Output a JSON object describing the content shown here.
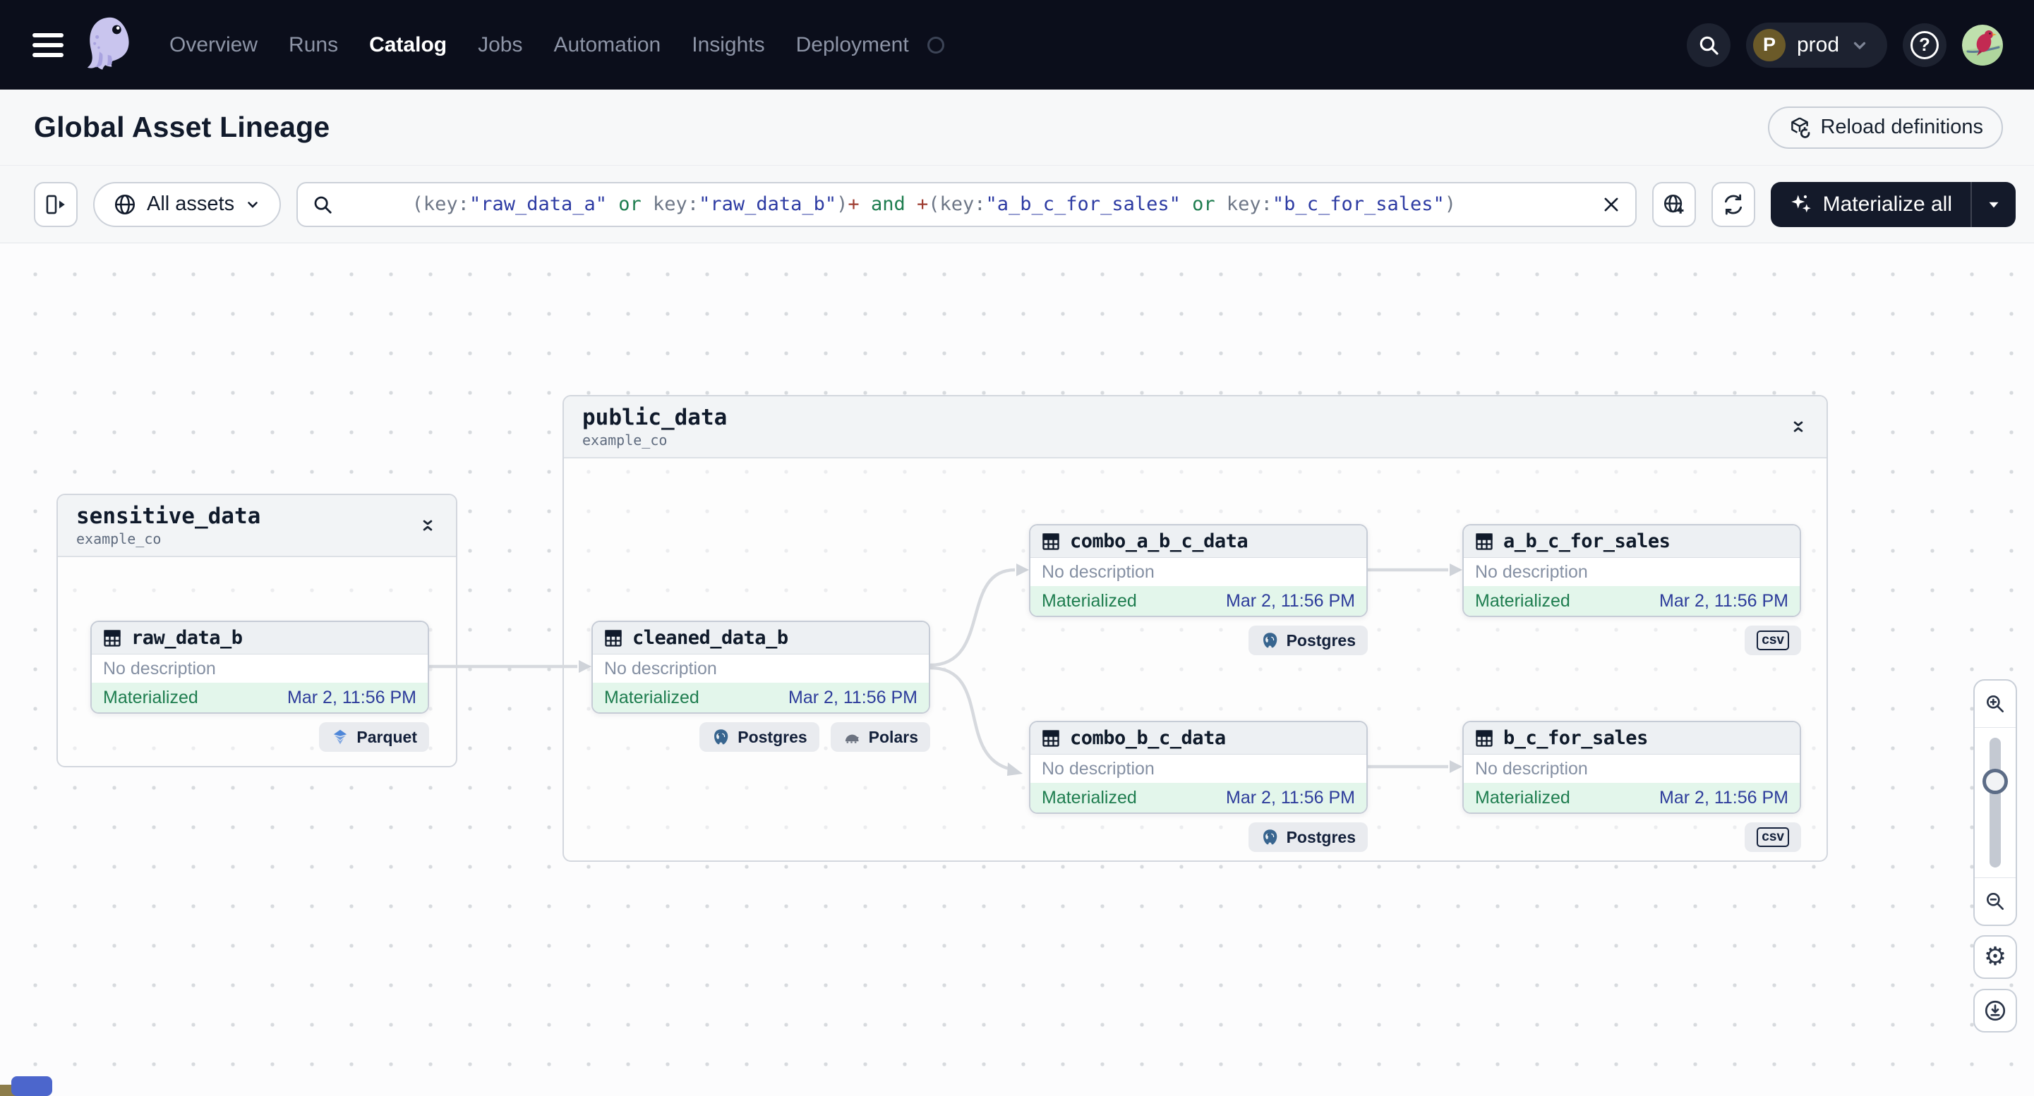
{
  "nav": {
    "menu": [
      "Overview",
      "Runs",
      "Catalog",
      "Jobs",
      "Automation",
      "Insights",
      "Deployment"
    ],
    "active": "Catalog",
    "env": {
      "initial": "P",
      "name": "prod"
    }
  },
  "header": {
    "title": "Global Asset Lineage",
    "reload": "Reload definitions"
  },
  "toolbar": {
    "scope": "All assets",
    "materialize": "Materialize all",
    "query_tokens": [
      {
        "t": "(key:"
      },
      {
        "t": "\"raw_data_a\""
      },
      {
        "t": " or "
      },
      {
        "t": "key:"
      },
      {
        "t": "\"raw_data_b\""
      },
      {
        "t": ")"
      },
      {
        "t": "+"
      },
      {
        "t": " and "
      },
      {
        "t": "+"
      },
      {
        "t": "(key:"
      },
      {
        "t": "\"a_b_c_for_sales\""
      },
      {
        "t": " or "
      },
      {
        "t": "key:"
      },
      {
        "t": "\"b_c_for_sales\""
      },
      {
        "t": ")"
      }
    ]
  },
  "graph": {
    "groups": {
      "sensitive": {
        "name": "sensitive_data",
        "repo": "example_co"
      },
      "public": {
        "name": "public_data",
        "repo": "example_co"
      }
    },
    "assets": {
      "raw_data_b": {
        "name": "raw_data_b",
        "desc": "No description",
        "status": "Materialized",
        "time": "Mar 2, 11:56 PM",
        "badges": [
          "Parquet"
        ]
      },
      "cleaned_data_b": {
        "name": "cleaned_data_b",
        "desc": "No description",
        "status": "Materialized",
        "time": "Mar 2, 11:56 PM",
        "badges": [
          "Postgres",
          "Polars"
        ]
      },
      "combo_a_b_c_data": {
        "name": "combo_a_b_c_data",
        "desc": "No description",
        "status": "Materialized",
        "time": "Mar 2, 11:56 PM",
        "badges": [
          "Postgres"
        ]
      },
      "a_b_c_for_sales": {
        "name": "a_b_c_for_sales",
        "desc": "No description",
        "status": "Materialized",
        "time": "Mar 2, 11:56 PM",
        "badges": [
          "csv"
        ]
      },
      "combo_b_c_data": {
        "name": "combo_b_c_data",
        "desc": "No description",
        "status": "Materialized",
        "time": "Mar 2, 11:56 PM",
        "badges": [
          "Postgres"
        ]
      },
      "b_c_for_sales": {
        "name": "b_c_for_sales",
        "desc": "No description",
        "status": "Materialized",
        "time": "Mar 2, 11:56 PM",
        "badges": [
          "csv"
        ]
      }
    },
    "edges": [
      "raw_data_b -> cleaned_data_b",
      "cleaned_data_b -> combo_a_b_c_data",
      "cleaned_data_b -> combo_b_c_data",
      "combo_a_b_c_data -> a_b_c_for_sales",
      "combo_b_c_data -> b_c_for_sales"
    ]
  },
  "colors": {
    "nav_bg": "#0b0e1b",
    "status_green": "#1e7d4f",
    "status_green_bg": "#e3f6eb",
    "timestamp_blue": "#2d3c9b",
    "query_string": "#2d3ba3",
    "query_logic": "#1e7d4f",
    "query_plus": "#9e3b2f",
    "edge_gray": "#d6d9de"
  }
}
